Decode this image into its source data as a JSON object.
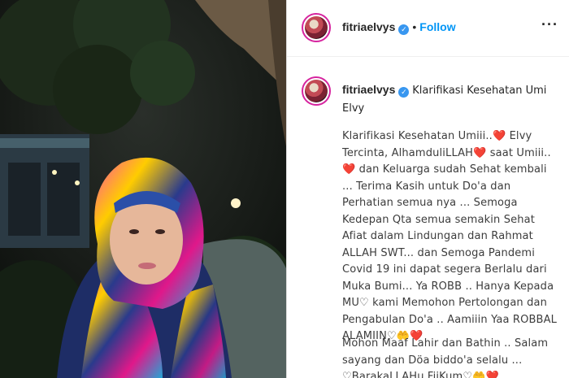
{
  "header": {
    "username": "fitriaelvys",
    "separator": "•",
    "follow_label": "Follow",
    "more_label": "···"
  },
  "caption": {
    "username": "fitriaelvys",
    "title": "Klarifikasi Kesehatan Umi Elvy",
    "body": "Klarifikasi Kesehatan Umiii..❤️ Elvy Tercinta, AlhamduliLLAH❤️ saat Umiii..❤️ dan Keluarga sudah Sehat kembali ... Terima Kasih untuk Do'a dan Perhatian semua nya ... Semoga Kedepan Qta semua semakin Sehat Afiat dalam Lindungan dan Rahmat ALLAH SWT... dan Semoga Pandemi Covid 19 ini dapat segera Berlalu dari Muka Bumi... Ya ROBB .. Hanya Kepada MU♡ kami Memohon Pertolongan dan Pengabulan Do'a .. Aamiiin Yaa ROBBAL ALAMIIN♡🤲❤️",
    "body2": "Mohon Maaf Lahir dan Bathin .. Salam sayang dan Döa biddo'a selalu ... ♡BarakaLLAHu FiiKum♡🤲❤️"
  },
  "icons": {
    "verified": "verified-badge-icon",
    "more": "more-options-icon"
  },
  "colors": {
    "follow": "#0095f6",
    "verified": "#3897f0",
    "story_ring": "#d6249f"
  }
}
